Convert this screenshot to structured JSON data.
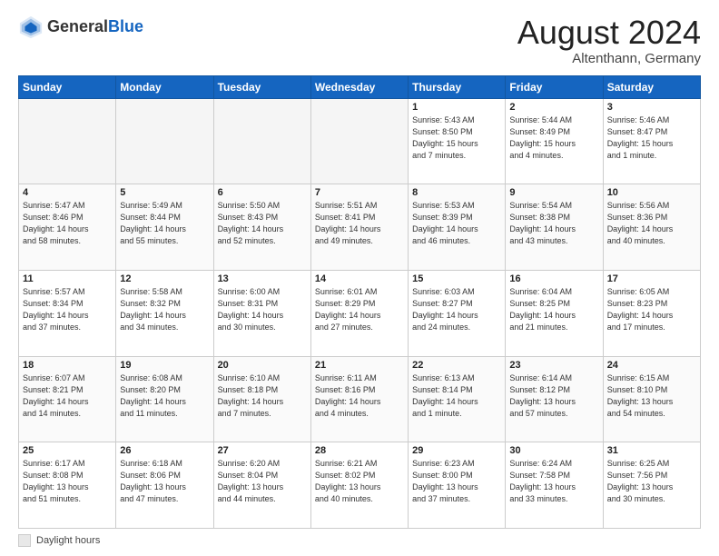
{
  "header": {
    "logo_general": "General",
    "logo_blue": "Blue",
    "month_title": "August 2024",
    "location": "Altenthann, Germany"
  },
  "calendar": {
    "days_of_week": [
      "Sunday",
      "Monday",
      "Tuesday",
      "Wednesday",
      "Thursday",
      "Friday",
      "Saturday"
    ],
    "weeks": [
      [
        {
          "day": "",
          "info": ""
        },
        {
          "day": "",
          "info": ""
        },
        {
          "day": "",
          "info": ""
        },
        {
          "day": "",
          "info": ""
        },
        {
          "day": "1",
          "info": "Sunrise: 5:43 AM\nSunset: 8:50 PM\nDaylight: 15 hours\nand 7 minutes."
        },
        {
          "day": "2",
          "info": "Sunrise: 5:44 AM\nSunset: 8:49 PM\nDaylight: 15 hours\nand 4 minutes."
        },
        {
          "day": "3",
          "info": "Sunrise: 5:46 AM\nSunset: 8:47 PM\nDaylight: 15 hours\nand 1 minute."
        }
      ],
      [
        {
          "day": "4",
          "info": "Sunrise: 5:47 AM\nSunset: 8:46 PM\nDaylight: 14 hours\nand 58 minutes."
        },
        {
          "day": "5",
          "info": "Sunrise: 5:49 AM\nSunset: 8:44 PM\nDaylight: 14 hours\nand 55 minutes."
        },
        {
          "day": "6",
          "info": "Sunrise: 5:50 AM\nSunset: 8:43 PM\nDaylight: 14 hours\nand 52 minutes."
        },
        {
          "day": "7",
          "info": "Sunrise: 5:51 AM\nSunset: 8:41 PM\nDaylight: 14 hours\nand 49 minutes."
        },
        {
          "day": "8",
          "info": "Sunrise: 5:53 AM\nSunset: 8:39 PM\nDaylight: 14 hours\nand 46 minutes."
        },
        {
          "day": "9",
          "info": "Sunrise: 5:54 AM\nSunset: 8:38 PM\nDaylight: 14 hours\nand 43 minutes."
        },
        {
          "day": "10",
          "info": "Sunrise: 5:56 AM\nSunset: 8:36 PM\nDaylight: 14 hours\nand 40 minutes."
        }
      ],
      [
        {
          "day": "11",
          "info": "Sunrise: 5:57 AM\nSunset: 8:34 PM\nDaylight: 14 hours\nand 37 minutes."
        },
        {
          "day": "12",
          "info": "Sunrise: 5:58 AM\nSunset: 8:32 PM\nDaylight: 14 hours\nand 34 minutes."
        },
        {
          "day": "13",
          "info": "Sunrise: 6:00 AM\nSunset: 8:31 PM\nDaylight: 14 hours\nand 30 minutes."
        },
        {
          "day": "14",
          "info": "Sunrise: 6:01 AM\nSunset: 8:29 PM\nDaylight: 14 hours\nand 27 minutes."
        },
        {
          "day": "15",
          "info": "Sunrise: 6:03 AM\nSunset: 8:27 PM\nDaylight: 14 hours\nand 24 minutes."
        },
        {
          "day": "16",
          "info": "Sunrise: 6:04 AM\nSunset: 8:25 PM\nDaylight: 14 hours\nand 21 minutes."
        },
        {
          "day": "17",
          "info": "Sunrise: 6:05 AM\nSunset: 8:23 PM\nDaylight: 14 hours\nand 17 minutes."
        }
      ],
      [
        {
          "day": "18",
          "info": "Sunrise: 6:07 AM\nSunset: 8:21 PM\nDaylight: 14 hours\nand 14 minutes."
        },
        {
          "day": "19",
          "info": "Sunrise: 6:08 AM\nSunset: 8:20 PM\nDaylight: 14 hours\nand 11 minutes."
        },
        {
          "day": "20",
          "info": "Sunrise: 6:10 AM\nSunset: 8:18 PM\nDaylight: 14 hours\nand 7 minutes."
        },
        {
          "day": "21",
          "info": "Sunrise: 6:11 AM\nSunset: 8:16 PM\nDaylight: 14 hours\nand 4 minutes."
        },
        {
          "day": "22",
          "info": "Sunrise: 6:13 AM\nSunset: 8:14 PM\nDaylight: 14 hours\nand 1 minute."
        },
        {
          "day": "23",
          "info": "Sunrise: 6:14 AM\nSunset: 8:12 PM\nDaylight: 13 hours\nand 57 minutes."
        },
        {
          "day": "24",
          "info": "Sunrise: 6:15 AM\nSunset: 8:10 PM\nDaylight: 13 hours\nand 54 minutes."
        }
      ],
      [
        {
          "day": "25",
          "info": "Sunrise: 6:17 AM\nSunset: 8:08 PM\nDaylight: 13 hours\nand 51 minutes."
        },
        {
          "day": "26",
          "info": "Sunrise: 6:18 AM\nSunset: 8:06 PM\nDaylight: 13 hours\nand 47 minutes."
        },
        {
          "day": "27",
          "info": "Sunrise: 6:20 AM\nSunset: 8:04 PM\nDaylight: 13 hours\nand 44 minutes."
        },
        {
          "day": "28",
          "info": "Sunrise: 6:21 AM\nSunset: 8:02 PM\nDaylight: 13 hours\nand 40 minutes."
        },
        {
          "day": "29",
          "info": "Sunrise: 6:23 AM\nSunset: 8:00 PM\nDaylight: 13 hours\nand 37 minutes."
        },
        {
          "day": "30",
          "info": "Sunrise: 6:24 AM\nSunset: 7:58 PM\nDaylight: 13 hours\nand 33 minutes."
        },
        {
          "day": "31",
          "info": "Sunrise: 6:25 AM\nSunset: 7:56 PM\nDaylight: 13 hours\nand 30 minutes."
        }
      ]
    ]
  },
  "footer": {
    "legend_label": "Daylight hours"
  }
}
